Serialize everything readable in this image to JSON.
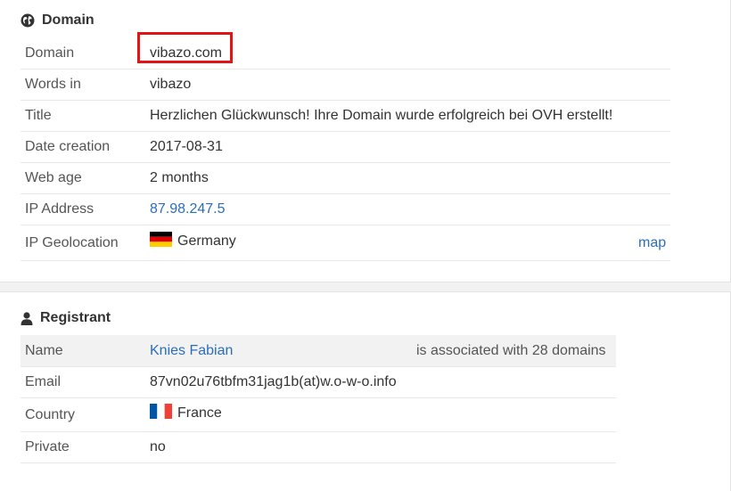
{
  "domain_section": {
    "title": "Domain",
    "icon": "globe-icon",
    "rows": {
      "domain": {
        "label": "Domain",
        "value": "vibazo.com"
      },
      "words_in": {
        "label": "Words in",
        "value": "vibazo"
      },
      "title": {
        "label": "Title",
        "value": "Herzlichen Glückwunsch! Ihre Domain wurde erfolgreich bei OVH erstellt!"
      },
      "date_creation": {
        "label": "Date creation",
        "value": "2017-08-31"
      },
      "web_age": {
        "label": "Web age",
        "value": "2 months"
      },
      "ip_address": {
        "label": "IP Address",
        "value": "87.98.247.5"
      },
      "ip_geolocation": {
        "label": "IP Geolocation",
        "value": "Germany",
        "flag": "germany-flag-icon",
        "map_link": "map"
      }
    }
  },
  "registrant_section": {
    "title": "Registrant",
    "icon": "user-icon",
    "rows": {
      "name": {
        "label": "Name",
        "value": "Knies Fabian",
        "note": "is associated with 28 domains"
      },
      "email": {
        "label": "Email",
        "value": "87vn02u76tbfm31jag1b(at)w.o-w-o.info"
      },
      "country": {
        "label": "Country",
        "value": "France",
        "flag": "france-flag-icon"
      },
      "private": {
        "label": "Private",
        "value": "no"
      }
    }
  },
  "colors": {
    "link": "#2a6ebb",
    "highlight": "#e01515",
    "shaded_row": "#f2f2f2"
  }
}
